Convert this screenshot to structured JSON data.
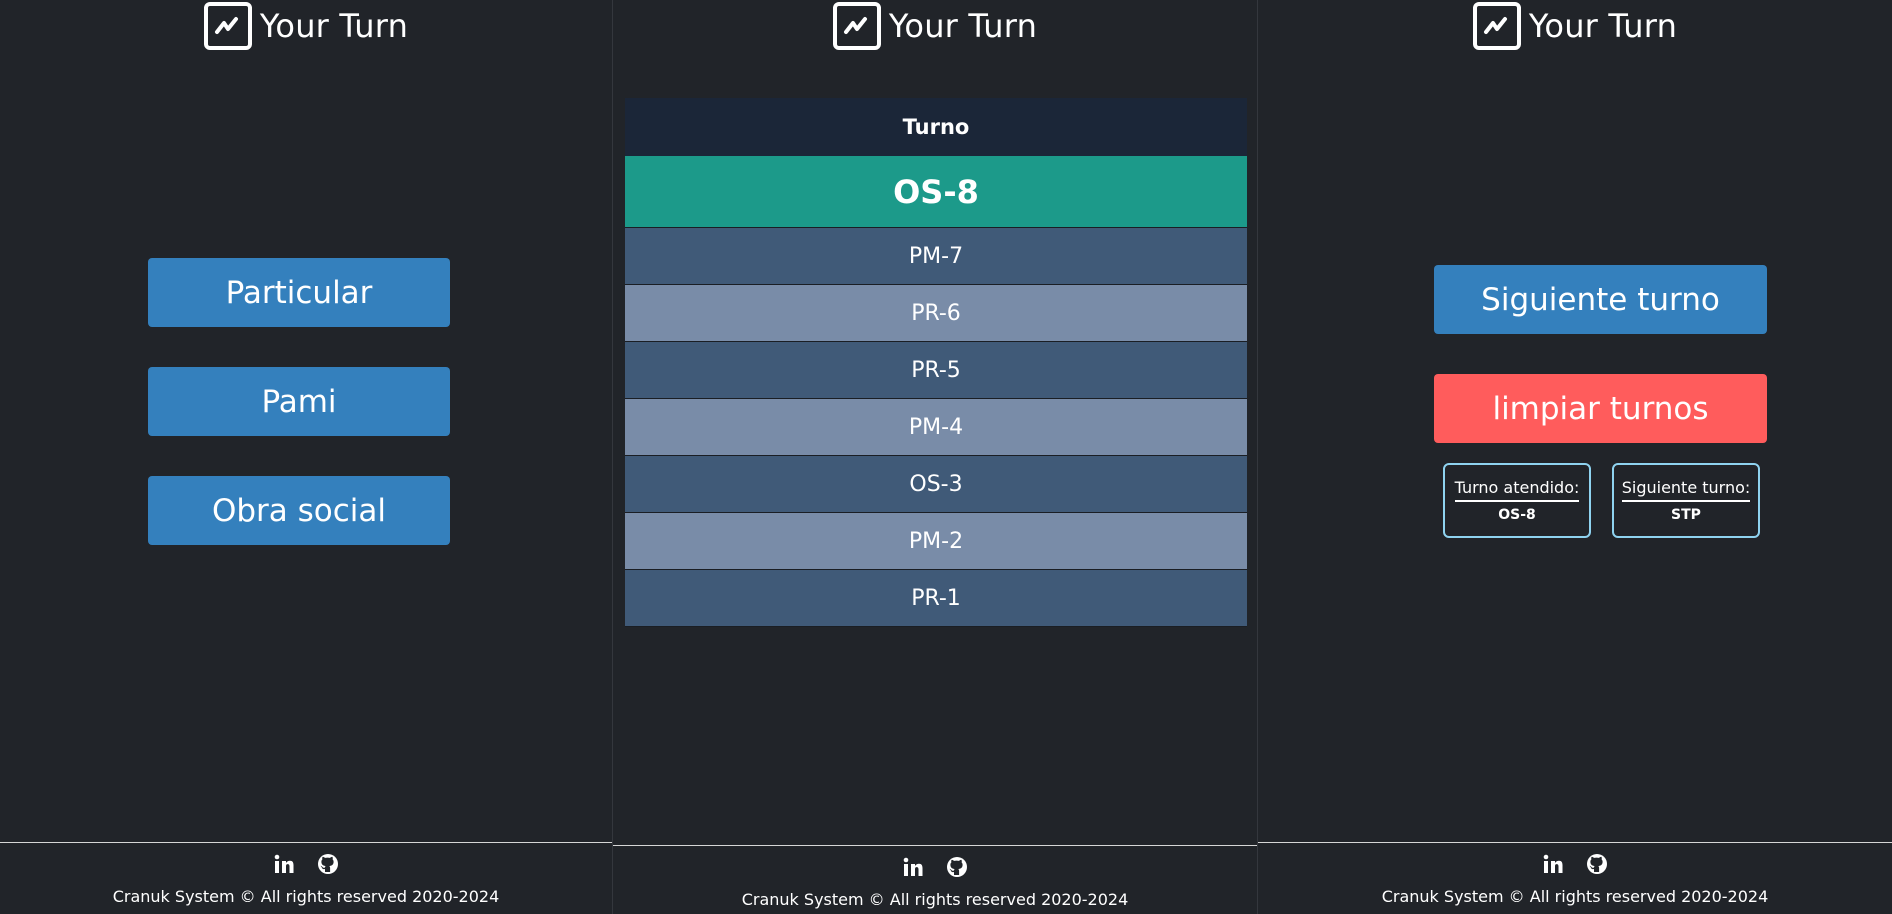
{
  "brand": {
    "title": "Your Turn",
    "logo_icon": "trend-chart-icon"
  },
  "selector": {
    "buttons": [
      "Particular",
      "Pami",
      "Obra social"
    ]
  },
  "queue": {
    "header": "Turno",
    "current": "OS-8",
    "rows": [
      "PM-7",
      "PR-6",
      "PR-5",
      "PM-4",
      "OS-3",
      "PM-2",
      "PR-1"
    ]
  },
  "control": {
    "next_label": "Siguiente turno",
    "clear_label": "limpiar turnos",
    "attended_label": "Turno atendido:",
    "attended_value": "OS-8",
    "next_turn_label": "Siguiente turno:",
    "next_turn_value": "STP"
  },
  "footer": {
    "copyright": "Cranuk System © All rights reserved 2020-2024",
    "icons": [
      "linkedin-icon",
      "github-icon"
    ]
  },
  "colors": {
    "background": "#212429",
    "primary_button": "#3480bd",
    "danger_button": "#ff5c5c",
    "current_turn": "#1c9a8a",
    "table_header": "#1b2638",
    "row_dark": "#405a78",
    "row_light": "#798ca8",
    "info_border": "#8fd3f0"
  }
}
